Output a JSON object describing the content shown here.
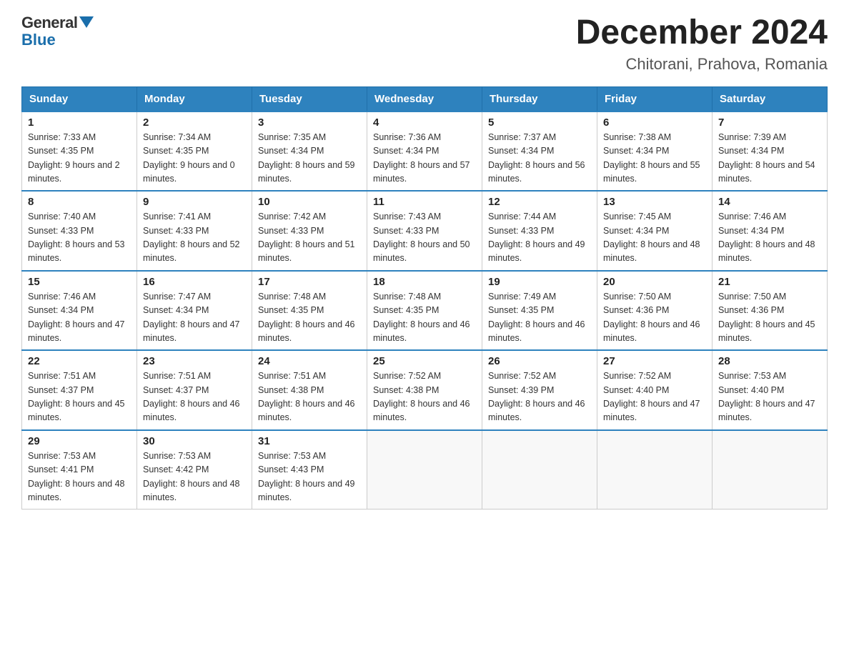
{
  "logo": {
    "general": "General",
    "blue": "Blue"
  },
  "title": "December 2024",
  "subtitle": "Chitorani, Prahova, Romania",
  "days_of_week": [
    "Sunday",
    "Monday",
    "Tuesday",
    "Wednesday",
    "Thursday",
    "Friday",
    "Saturday"
  ],
  "weeks": [
    [
      {
        "day": "1",
        "sunrise": "7:33 AM",
        "sunset": "4:35 PM",
        "daylight": "9 hours and 2 minutes."
      },
      {
        "day": "2",
        "sunrise": "7:34 AM",
        "sunset": "4:35 PM",
        "daylight": "9 hours and 0 minutes."
      },
      {
        "day": "3",
        "sunrise": "7:35 AM",
        "sunset": "4:34 PM",
        "daylight": "8 hours and 59 minutes."
      },
      {
        "day": "4",
        "sunrise": "7:36 AM",
        "sunset": "4:34 PM",
        "daylight": "8 hours and 57 minutes."
      },
      {
        "day": "5",
        "sunrise": "7:37 AM",
        "sunset": "4:34 PM",
        "daylight": "8 hours and 56 minutes."
      },
      {
        "day": "6",
        "sunrise": "7:38 AM",
        "sunset": "4:34 PM",
        "daylight": "8 hours and 55 minutes."
      },
      {
        "day": "7",
        "sunrise": "7:39 AM",
        "sunset": "4:34 PM",
        "daylight": "8 hours and 54 minutes."
      }
    ],
    [
      {
        "day": "8",
        "sunrise": "7:40 AM",
        "sunset": "4:33 PM",
        "daylight": "8 hours and 53 minutes."
      },
      {
        "day": "9",
        "sunrise": "7:41 AM",
        "sunset": "4:33 PM",
        "daylight": "8 hours and 52 minutes."
      },
      {
        "day": "10",
        "sunrise": "7:42 AM",
        "sunset": "4:33 PM",
        "daylight": "8 hours and 51 minutes."
      },
      {
        "day": "11",
        "sunrise": "7:43 AM",
        "sunset": "4:33 PM",
        "daylight": "8 hours and 50 minutes."
      },
      {
        "day": "12",
        "sunrise": "7:44 AM",
        "sunset": "4:33 PM",
        "daylight": "8 hours and 49 minutes."
      },
      {
        "day": "13",
        "sunrise": "7:45 AM",
        "sunset": "4:34 PM",
        "daylight": "8 hours and 48 minutes."
      },
      {
        "day": "14",
        "sunrise": "7:46 AM",
        "sunset": "4:34 PM",
        "daylight": "8 hours and 48 minutes."
      }
    ],
    [
      {
        "day": "15",
        "sunrise": "7:46 AM",
        "sunset": "4:34 PM",
        "daylight": "8 hours and 47 minutes."
      },
      {
        "day": "16",
        "sunrise": "7:47 AM",
        "sunset": "4:34 PM",
        "daylight": "8 hours and 47 minutes."
      },
      {
        "day": "17",
        "sunrise": "7:48 AM",
        "sunset": "4:35 PM",
        "daylight": "8 hours and 46 minutes."
      },
      {
        "day": "18",
        "sunrise": "7:48 AM",
        "sunset": "4:35 PM",
        "daylight": "8 hours and 46 minutes."
      },
      {
        "day": "19",
        "sunrise": "7:49 AM",
        "sunset": "4:35 PM",
        "daylight": "8 hours and 46 minutes."
      },
      {
        "day": "20",
        "sunrise": "7:50 AM",
        "sunset": "4:36 PM",
        "daylight": "8 hours and 46 minutes."
      },
      {
        "day": "21",
        "sunrise": "7:50 AM",
        "sunset": "4:36 PM",
        "daylight": "8 hours and 45 minutes."
      }
    ],
    [
      {
        "day": "22",
        "sunrise": "7:51 AM",
        "sunset": "4:37 PM",
        "daylight": "8 hours and 45 minutes."
      },
      {
        "day": "23",
        "sunrise": "7:51 AM",
        "sunset": "4:37 PM",
        "daylight": "8 hours and 46 minutes."
      },
      {
        "day": "24",
        "sunrise": "7:51 AM",
        "sunset": "4:38 PM",
        "daylight": "8 hours and 46 minutes."
      },
      {
        "day": "25",
        "sunrise": "7:52 AM",
        "sunset": "4:38 PM",
        "daylight": "8 hours and 46 minutes."
      },
      {
        "day": "26",
        "sunrise": "7:52 AM",
        "sunset": "4:39 PM",
        "daylight": "8 hours and 46 minutes."
      },
      {
        "day": "27",
        "sunrise": "7:52 AM",
        "sunset": "4:40 PM",
        "daylight": "8 hours and 47 minutes."
      },
      {
        "day": "28",
        "sunrise": "7:53 AM",
        "sunset": "4:40 PM",
        "daylight": "8 hours and 47 minutes."
      }
    ],
    [
      {
        "day": "29",
        "sunrise": "7:53 AM",
        "sunset": "4:41 PM",
        "daylight": "8 hours and 48 minutes."
      },
      {
        "day": "30",
        "sunrise": "7:53 AM",
        "sunset": "4:42 PM",
        "daylight": "8 hours and 48 minutes."
      },
      {
        "day": "31",
        "sunrise": "7:53 AM",
        "sunset": "4:43 PM",
        "daylight": "8 hours and 49 minutes."
      },
      null,
      null,
      null,
      null
    ]
  ]
}
